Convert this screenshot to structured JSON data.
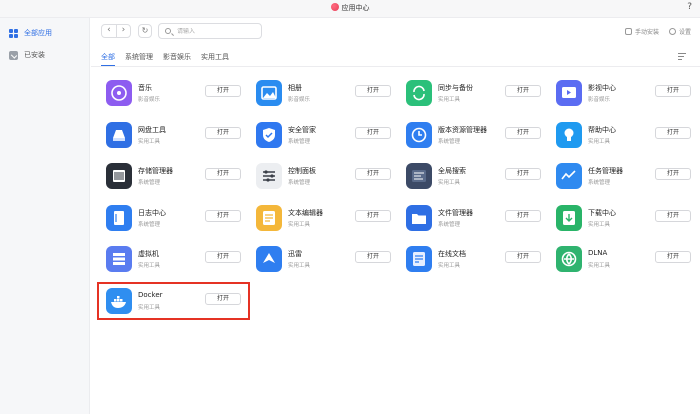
{
  "window": {
    "title": "应用中心",
    "help": "?"
  },
  "sidebar": {
    "items": [
      {
        "label": "全部应用",
        "active": true,
        "icon": "grid-icon"
      },
      {
        "label": "已安装",
        "active": false,
        "icon": "download-icon"
      }
    ]
  },
  "toolbar": {
    "back": "‹",
    "forward": "›",
    "refresh": "↻",
    "search_placeholder": "请输入",
    "manual_install": "手动安装",
    "settings": "设置"
  },
  "tabs": [
    "全部",
    "系统管理",
    "影音娱乐",
    "实用工具"
  ],
  "open_label": "打开",
  "apps": [
    {
      "name": "音乐",
      "category": "影音娱乐",
      "icon": "music-icon",
      "color": "#8d5cf0"
    },
    {
      "name": "相册",
      "category": "影音娱乐",
      "icon": "photo-icon",
      "color": "#2a8cf0"
    },
    {
      "name": "同步与备份",
      "category": "实用工具",
      "icon": "sync-icon",
      "color": "#2bc07a"
    },
    {
      "name": "影视中心",
      "category": "影音娱乐",
      "icon": "video-icon",
      "color": "#5b6cf2"
    },
    {
      "name": "网盘工具",
      "category": "实用工具",
      "icon": "cloud-drive-icon",
      "color": "#2f6fe4"
    },
    {
      "name": "安全管家",
      "category": "系统管理",
      "icon": "shield-icon",
      "color": "#2f78f0"
    },
    {
      "name": "版本资源管理器",
      "category": "系统管理",
      "icon": "version-icon",
      "color": "#2f7ef0"
    },
    {
      "name": "帮助中心",
      "category": "实用工具",
      "icon": "help-bulb-icon",
      "color": "#1f9af0"
    },
    {
      "name": "存储管理器",
      "category": "系统管理",
      "icon": "storage-icon",
      "color": "#2a2f38"
    },
    {
      "name": "控制面板",
      "category": "系统管理",
      "icon": "sliders-icon",
      "color": "#b0b6c0"
    },
    {
      "name": "全局搜索",
      "category": "实用工具",
      "icon": "search-panel-icon",
      "color": "#3c4a66"
    },
    {
      "name": "任务管理器",
      "category": "系统管理",
      "icon": "chart-icon",
      "color": "#2f8af0"
    },
    {
      "name": "日志中心",
      "category": "系统管理",
      "icon": "log-icon",
      "color": "#2f7ef0"
    },
    {
      "name": "文本编辑器",
      "category": "实用工具",
      "icon": "text-editor-icon",
      "color": "#f4b73a"
    },
    {
      "name": "文件管理器",
      "category": "系统管理",
      "icon": "folder-icon",
      "color": "#2f6fe4"
    },
    {
      "name": "下载中心",
      "category": "实用工具",
      "icon": "download-app-icon",
      "color": "#29b468"
    },
    {
      "name": "虚拟机",
      "category": "实用工具",
      "icon": "vm-icon",
      "color": "#5a7cf0"
    },
    {
      "name": "迅雷",
      "category": "实用工具",
      "icon": "thunder-icon",
      "color": "#2f7ef0"
    },
    {
      "name": "在线文档",
      "category": "实用工具",
      "icon": "document-icon",
      "color": "#2f7ef0"
    },
    {
      "name": "DLNA",
      "category": "实用工具",
      "icon": "dlna-icon",
      "color": "#2fb36f"
    },
    {
      "name": "Docker",
      "category": "实用工具",
      "icon": "docker-icon",
      "color": "#2f8ef0",
      "highlighted": true
    }
  ]
}
